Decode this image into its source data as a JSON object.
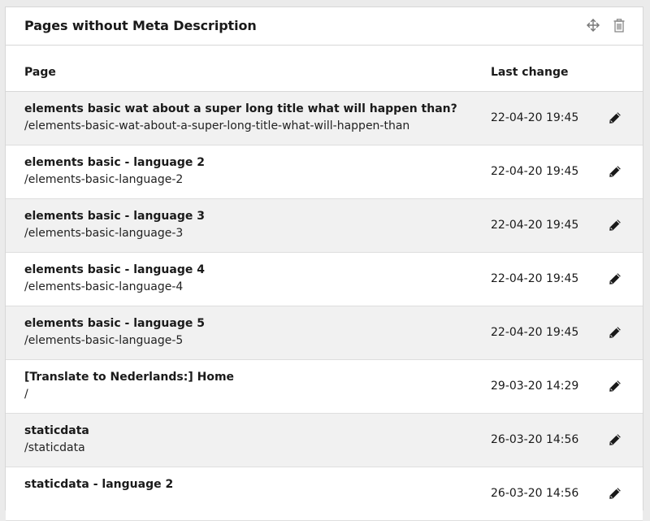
{
  "widget": {
    "title": "Pages without Meta Description",
    "move_icon": "move-icon",
    "delete_icon": "trash-icon"
  },
  "table": {
    "columns": [
      "Page",
      "Last change"
    ],
    "rows": [
      {
        "title": "elements basic wat about a super long title what will happen than?",
        "slug": "/elements-basic-wat-about-a-super-long-title-what-will-happen-than",
        "last_change": "22-04-20 19:45"
      },
      {
        "title": "elements basic - language 2",
        "slug": "/elements-basic-language-2",
        "last_change": "22-04-20 19:45"
      },
      {
        "title": "elements basic - language 3",
        "slug": "/elements-basic-language-3",
        "last_change": "22-04-20 19:45"
      },
      {
        "title": "elements basic - language 4",
        "slug": "/elements-basic-language-4",
        "last_change": "22-04-20 19:45"
      },
      {
        "title": "elements basic - language 5",
        "slug": "/elements-basic-language-5",
        "last_change": "22-04-20 19:45"
      },
      {
        "title": "[Translate to Nederlands:] Home",
        "slug": "/",
        "last_change": "29-03-20 14:29"
      },
      {
        "title": "staticdata",
        "slug": "/staticdata",
        "last_change": "26-03-20 14:56"
      },
      {
        "title": "staticdata - language 2",
        "slug": "",
        "last_change": "26-03-20 14:56"
      }
    ],
    "row_action_icon": "pencil-icon"
  },
  "colors": {
    "page_background": "#ebebeb",
    "row_striped": "#f1f1f1",
    "border": "#d7d7d7"
  }
}
